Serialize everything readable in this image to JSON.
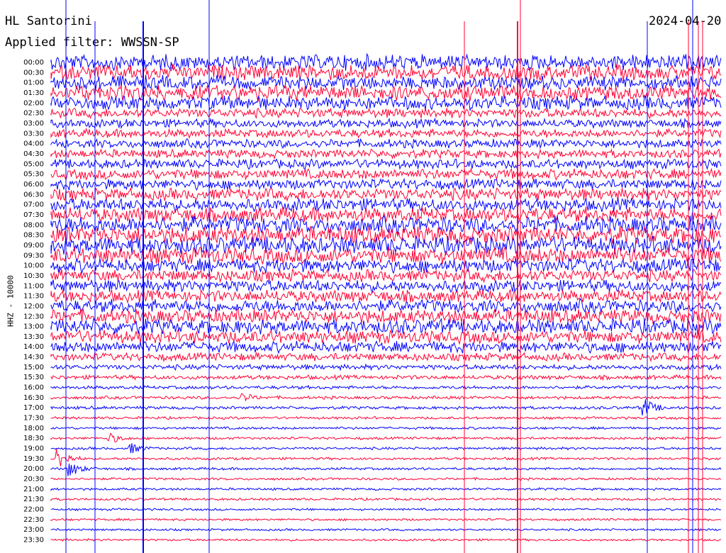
{
  "header": {
    "station": "HL Santorini",
    "date": "2024-04-20",
    "filter": "Applied filter: WWSSN-SP",
    "channel_label": "HHZ - 10000"
  },
  "colors": {
    "even_trace": "#0000ff",
    "odd_trace": "#ff0033"
  },
  "chart_data": {
    "type": "helicorder",
    "title": "HL Santorini",
    "subtitle": "Applied filter: WWSSN-SP",
    "date": "2024-04-20",
    "ylabel": "HHZ - 10000",
    "xlabel": "",
    "rows": [
      "00:00",
      "00:30",
      "01:00",
      "01:30",
      "02:00",
      "02:30",
      "03:00",
      "03:30",
      "04:00",
      "04:30",
      "05:00",
      "05:30",
      "06:00",
      "06:30",
      "07:00",
      "07:30",
      "08:00",
      "08:30",
      "09:00",
      "09:30",
      "10:00",
      "10:30",
      "11:00",
      "11:30",
      "12:00",
      "12:30",
      "13:00",
      "13:30",
      "14:00",
      "14:30",
      "15:00",
      "15:30",
      "16:00",
      "16:30",
      "17:00",
      "17:30",
      "18:00",
      "18:30",
      "19:00",
      "19:30",
      "20:00",
      "20:30",
      "21:00",
      "21:30",
      "22:00",
      "22:30",
      "23:00",
      "23:30"
    ],
    "row_minutes": 30,
    "relative_noise_amplitude": [
      0.9,
      0.9,
      0.8,
      0.9,
      0.8,
      0.55,
      0.5,
      0.5,
      0.5,
      0.5,
      0.55,
      0.6,
      0.6,
      0.7,
      0.75,
      0.85,
      0.95,
      1.0,
      1.0,
      0.95,
      0.8,
      0.7,
      0.7,
      0.7,
      0.75,
      0.8,
      0.85,
      0.75,
      0.65,
      0.45,
      0.3,
      0.25,
      0.2,
      0.18,
      0.18,
      0.15,
      0.15,
      0.15,
      0.15,
      0.15,
      0.15,
      0.14,
      0.14,
      0.14,
      0.13,
      0.13,
      0.13,
      0.13
    ],
    "events": [
      {
        "row": "17:00",
        "minute": 26.5,
        "amplitude": 1.0
      },
      {
        "row": "18:30",
        "minute": 2.5,
        "amplitude": 0.7
      },
      {
        "row": "19:00",
        "minute": 3.5,
        "amplitude": 0.6
      },
      {
        "row": "19:30",
        "minute": 0.3,
        "amplitude": 1.2
      },
      {
        "row": "20:00",
        "minute": 0.8,
        "amplitude": 0.9
      },
      {
        "row": "16:30",
        "minute": 8.5,
        "amplitude": 0.5
      }
    ]
  }
}
